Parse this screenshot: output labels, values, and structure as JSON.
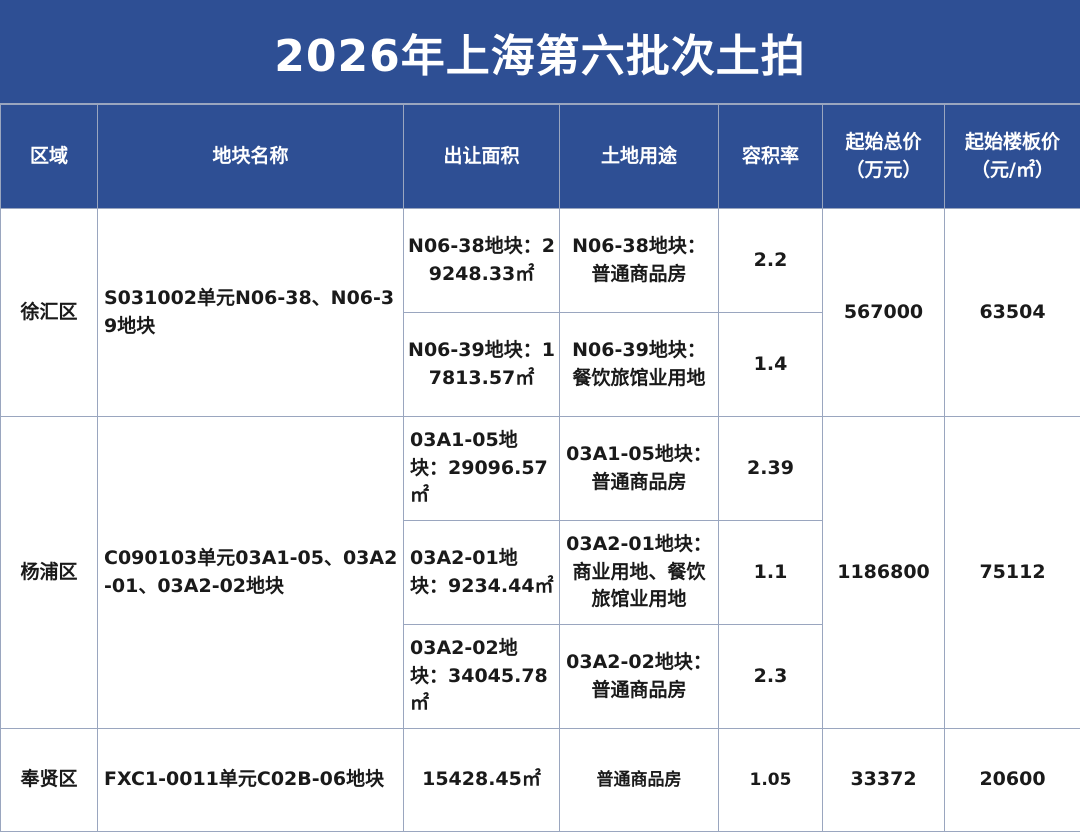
{
  "title": "2026年上海第六批次土拍",
  "headers": {
    "district": "区域",
    "parcel_name": "地块名称",
    "area": "出让面积",
    "land_use": "土地用途",
    "far": "容积率",
    "start_total_l1": "起始总价",
    "start_total_l2": "（万元）",
    "start_unit_l1": "起始楼板价",
    "start_unit_l2": "（元/㎡）"
  },
  "groups": [
    {
      "district": "徐汇区",
      "parcel_name": "S031002单元N06-38、N06-39地块",
      "start_total": "567000",
      "start_unit": "63504",
      "plots": [
        {
          "area": "N06-38地块：29248.33㎡",
          "land_use": "N06-38地块：普通商品房",
          "far": "2.2"
        },
        {
          "area": "N06-39地块：17813.57㎡",
          "land_use": "N06-39地块：餐饮旅馆业用地",
          "far": "1.4"
        }
      ]
    },
    {
      "district": "杨浦区",
      "parcel_name": "C090103单元03A1-05、03A2-01、03A2-02地块",
      "start_total": "1186800",
      "start_unit": "75112",
      "plots": [
        {
          "area": "03A1-05地块：29096.57㎡",
          "land_use": "03A1-05地块：普通商品房",
          "far": "2.39"
        },
        {
          "area": "03A2-01地块：9234.44㎡",
          "land_use": "03A2-01地块：商业用地、餐饮旅馆业用地",
          "far": "1.1"
        },
        {
          "area": "03A2-02地块：34045.78㎡",
          "land_use": "03A2-02地块：普通商品房",
          "far": "2.3"
        }
      ]
    },
    {
      "district": "奉贤区",
      "parcel_name": "FXC1-0011单元C02B-06地块",
      "start_total": "33372",
      "start_unit": "20600",
      "plots": [
        {
          "area": "15428.45㎡",
          "land_use": "普通商品房",
          "far": "1.05"
        }
      ]
    }
  ]
}
